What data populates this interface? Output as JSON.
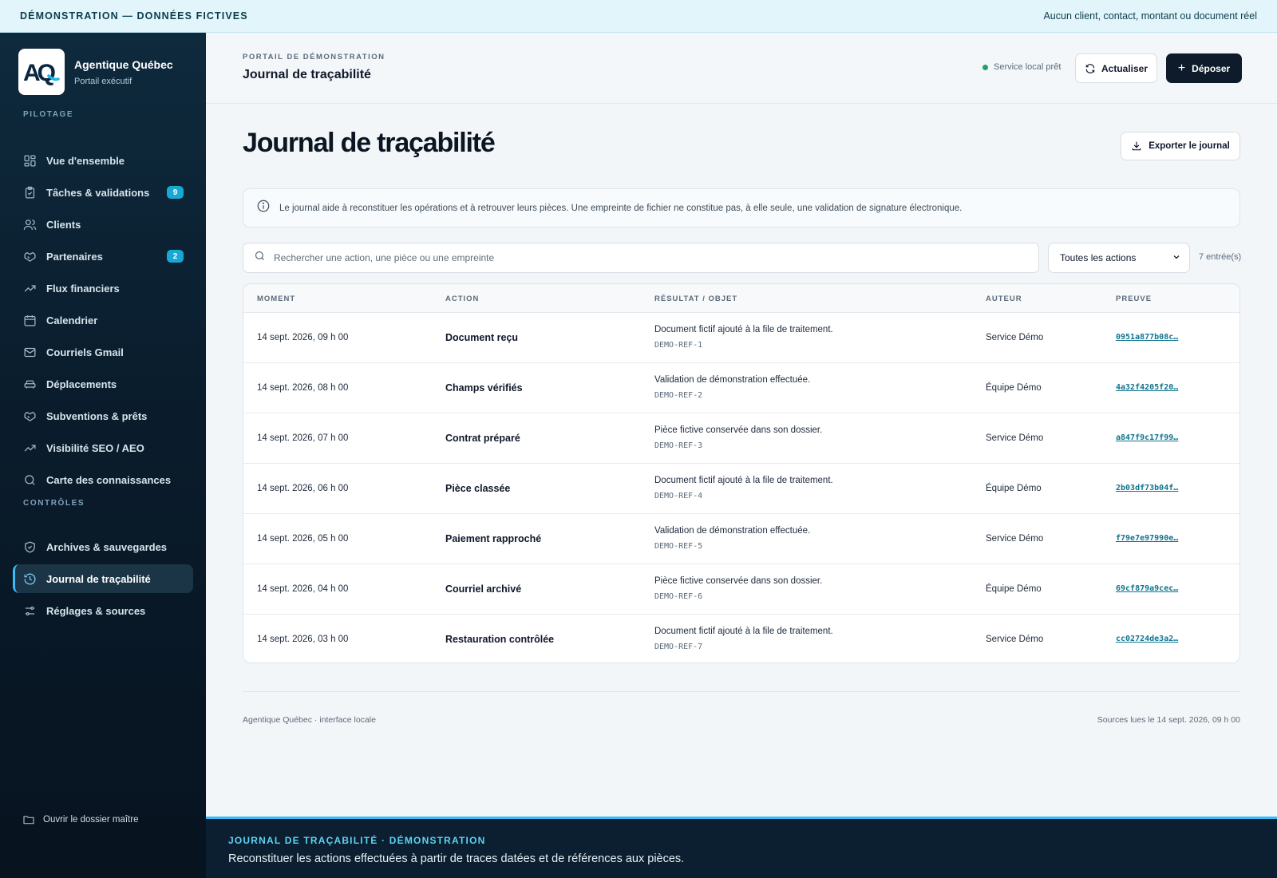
{
  "banner": {
    "left": "DÉMONSTRATION — DONNÉES FICTIVES",
    "right": "Aucun client, contact, montant ou document réel"
  },
  "brand": {
    "name": "Agentique Québec",
    "subtitle": "Portail exécutif",
    "logo_text": "AQ"
  },
  "sidebar": {
    "section_pilotage": "PILOTAGE",
    "items": [
      {
        "label": "Vue d'ensemble",
        "icon": "grid-icon"
      },
      {
        "label": "Tâches & validations",
        "icon": "clipboard-check-icon",
        "badge": "9"
      },
      {
        "label": "Clients",
        "icon": "users-icon"
      },
      {
        "label": "Partenaires",
        "icon": "handshake-icon",
        "badge": "2"
      },
      {
        "label": "Flux financiers",
        "icon": "trend-up-icon"
      },
      {
        "label": "Calendrier",
        "icon": "calendar-icon"
      },
      {
        "label": "Courriels Gmail",
        "icon": "mail-icon"
      },
      {
        "label": "Déplacements",
        "icon": "car-icon"
      },
      {
        "label": "Subventions & prêts",
        "icon": "handshake-icon"
      },
      {
        "label": "Visibilité SEO / AEO",
        "icon": "trend-up-icon"
      },
      {
        "label": "Carte des connaissances",
        "icon": "search-icon"
      }
    ],
    "section_controles": "CONTRÔLES",
    "items_controles": [
      {
        "label": "Archives & sauvegardes",
        "icon": "shield-check-icon"
      },
      {
        "label": "Journal de traçabilité",
        "icon": "history-icon",
        "active": true
      },
      {
        "label": "Réglages & sources",
        "icon": "sliders-icon"
      }
    ],
    "footer": "Ouvrir le dossier maître"
  },
  "header": {
    "eyebrow": "PORTAIL DE DÉMONSTRATION",
    "title": "Journal de traçabilité",
    "status": "Service local prêt",
    "refresh_label": "Actualiser",
    "deposit_label": "Déposer"
  },
  "main": {
    "title": "Journal de traçabilité",
    "export_label": "Exporter le journal",
    "info": "Le journal aide à reconstituer les opérations et à retrouver leurs pièces. Une empreinte de fichier ne constitue pas, à elle seule, une validation de signature électronique.",
    "search_placeholder": "Rechercher une action, une pièce ou une empreinte",
    "filter_value": "Toutes les actions",
    "count": "7 entrée(s)"
  },
  "table": {
    "columns": [
      "MOMENT",
      "ACTION",
      "RÉSULTAT / OBJET",
      "AUTEUR",
      "PREUVE"
    ],
    "rows": [
      {
        "moment": "14 sept. 2026, 09 h 00",
        "action": "Document reçu",
        "result": "Document fictif ajouté à la file de traitement.",
        "ref": "DEMO-REF-1",
        "author": "Service Démo",
        "proof": "0951a877b08c…"
      },
      {
        "moment": "14 sept. 2026, 08 h 00",
        "action": "Champs vérifiés",
        "result": "Validation de démonstration effectuée.",
        "ref": "DEMO-REF-2",
        "author": "Équipe Démo",
        "proof": "4a32f4205f20…"
      },
      {
        "moment": "14 sept. 2026, 07 h 00",
        "action": "Contrat préparé",
        "result": "Pièce fictive conservée dans son dossier.",
        "ref": "DEMO-REF-3",
        "author": "Service Démo",
        "proof": "a847f9c17f99…"
      },
      {
        "moment": "14 sept. 2026, 06 h 00",
        "action": "Pièce classée",
        "result": "Document fictif ajouté à la file de traitement.",
        "ref": "DEMO-REF-4",
        "author": "Équipe Démo",
        "proof": "2b03df73b04f…"
      },
      {
        "moment": "14 sept. 2026, 05 h 00",
        "action": "Paiement rapproché",
        "result": "Validation de démonstration effectuée.",
        "ref": "DEMO-REF-5",
        "author": "Service Démo",
        "proof": "f79e7e97990e…"
      },
      {
        "moment": "14 sept. 2026, 04 h 00",
        "action": "Courriel archivé",
        "result": "Pièce fictive conservée dans son dossier.",
        "ref": "DEMO-REF-6",
        "author": "Équipe Démo",
        "proof": "69cf879a9cec…"
      },
      {
        "moment": "14 sept. 2026, 03 h 00",
        "action": "Restauration contrôlée",
        "result": "Document fictif ajouté à la file de traitement.",
        "ref": "DEMO-REF-7",
        "author": "Service Démo",
        "proof": "cc02724de3a2…"
      }
    ]
  },
  "footer": {
    "left": "Agentique Québec · interface locale",
    "right": "Sources lues le 14 sept. 2026, 09 h 00"
  },
  "bottom_band": {
    "eyebrow": "JOURNAL DE TRAÇABILITÉ · DÉMONSTRATION",
    "description": "Reconstituer les actions effectuées à partir de traces datées et de références aux pièces."
  }
}
